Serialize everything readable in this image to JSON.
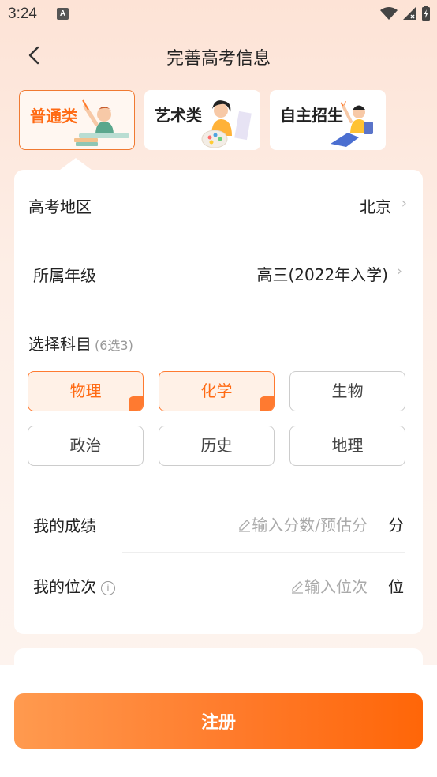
{
  "status": {
    "time": "3:24"
  },
  "nav": {
    "title": "完善高考信息"
  },
  "tabs": [
    {
      "label": "普通类",
      "active": true
    },
    {
      "label": "艺术类",
      "active": false
    },
    {
      "label": "自主招生",
      "active": false
    }
  ],
  "form": {
    "region": {
      "label": "高考地区",
      "value": "北京"
    },
    "grade": {
      "label": "所属年级",
      "value": "高三(2022年入学)"
    },
    "subjects": {
      "title": "选择科目",
      "hint": "(6选3)",
      "items": [
        {
          "label": "物理",
          "selected": true
        },
        {
          "label": "化学",
          "selected": true
        },
        {
          "label": "生物",
          "selected": false
        },
        {
          "label": "政治",
          "selected": false
        },
        {
          "label": "历史",
          "selected": false
        },
        {
          "label": "地理",
          "selected": false
        }
      ]
    },
    "score": {
      "label": "我的成绩",
      "placeholder": "输入分数/预估分",
      "unit": "分"
    },
    "rank": {
      "label": "我的位次",
      "placeholder": "输入位次",
      "unit": "位"
    }
  },
  "submit": {
    "label": "注册"
  },
  "colors": {
    "accent": "#ff6a13",
    "accent_light": "#fff1e7"
  }
}
